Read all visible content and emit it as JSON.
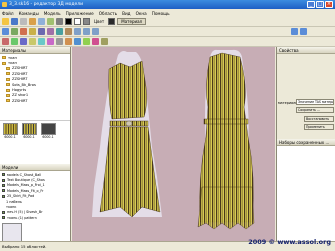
{
  "window": {
    "title": "3_3.sk16 - редактор 3Д модели"
  },
  "menu": [
    "Файл",
    "Команды",
    "Модель",
    "Приложение",
    "Область",
    "Вид",
    "Окна",
    "Помощь"
  ],
  "toolbar": {
    "color_label": "Цвет",
    "material_label": "Материал"
  },
  "materials_panel": {
    "title": "Материалы",
    "tree": [
      "ткан",
      "ткан",
      "ZZSHIRT",
      "ZZSHIRT",
      "ZZSHIRT",
      "Sots_Bk_Bros",
      "Hogyrts",
      "ZZ shor1",
      "ZZSHIRT"
    ],
    "thumbs": [
      "6000-1",
      "6000-1",
      "6000-1"
    ]
  },
  "models_panel": {
    "title": "Модели",
    "items": [
      "мodels C_Shost_Ball",
      "Text Boutique (C_Shos",
      "Models_Mass_p_Froi_1",
      "Models_Mass_Fit_o_Fr",
      "25_Skirt_Fit_Pad",
      "1 набель",
      "тканк",
      "печ.Н (5) | Sivesh_Br",
      "ткань (1) pattern"
    ]
  },
  "properties_panel": {
    "title": "Свойства",
    "label_materials": "материалы:",
    "field_copy": "Значение TAS материала",
    "button_save": "Сохранить ...",
    "button_restore": "Восстановить",
    "button_apply": "Применить"
  },
  "sets_panel": {
    "title": "Наборы сохраненных ..."
  },
  "status": {
    "text": "Выбрано 15 областей."
  },
  "watermark": "2009  ©  www.assol.org",
  "colors": {
    "canvas_bg": "#c7adb5",
    "stripe_yellow": "#d8cc52",
    "stripe_dark": "#4a3a1a"
  }
}
